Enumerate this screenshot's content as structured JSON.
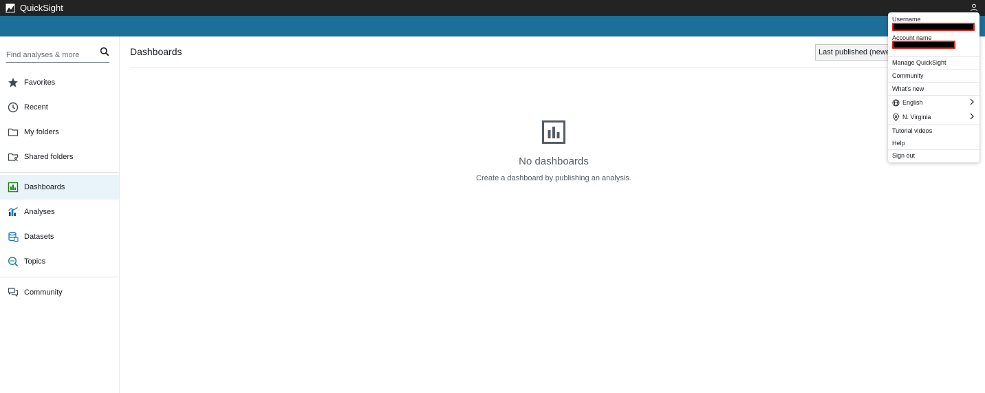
{
  "app": {
    "title": "QuickSight"
  },
  "sidebar": {
    "search_placeholder": "Find analyses & more",
    "items": [
      {
        "label": "Favorites",
        "icon": "star-icon"
      },
      {
        "label": "Recent",
        "icon": "clock-icon"
      },
      {
        "label": "My folders",
        "icon": "folder-icon"
      },
      {
        "label": "Shared folders",
        "icon": "shared-folder-icon"
      },
      {
        "label": "Dashboards",
        "icon": "dashboard-icon",
        "active": true
      },
      {
        "label": "Analyses",
        "icon": "analyses-icon"
      },
      {
        "label": "Datasets",
        "icon": "datasets-icon"
      },
      {
        "label": "Topics",
        "icon": "topics-icon"
      },
      {
        "label": "Community",
        "icon": "community-icon"
      }
    ]
  },
  "main": {
    "title": "Dashboards",
    "sort_label": "Last published (newest first)",
    "empty": {
      "title": "No dashboards",
      "subtitle": "Create a dashboard by publishing an analysis."
    }
  },
  "user_menu": {
    "username_label": "Username",
    "account_label": "Account name",
    "items": {
      "manage": "Manage QuickSight",
      "community": "Community",
      "whats_new": "What's new",
      "language": "English",
      "region": "N. Virginia",
      "tutorials": "Tutorial videos",
      "help": "Help",
      "sign_out": "Sign out"
    }
  },
  "colors": {
    "topbar": "#232323",
    "brandbar": "#1b6f98",
    "active_bg": "#e8f4fa",
    "accent_green": "#1d8102",
    "accent_blue": "#0972d3"
  }
}
